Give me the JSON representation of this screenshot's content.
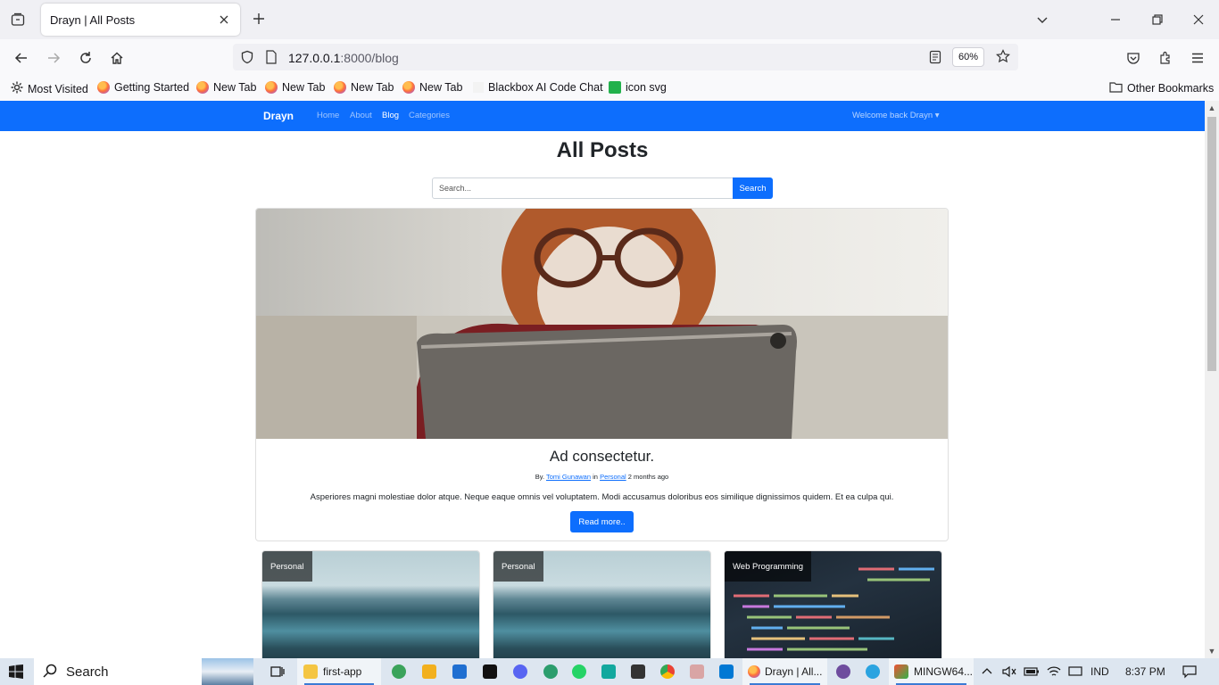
{
  "browser": {
    "tab_title": "Drayn | All Posts",
    "url_host": "127.0.0.1",
    "url_rest": ":8000/blog",
    "zoom": "60%"
  },
  "bookmarks": [
    "Most Visited",
    "Getting Started",
    "New Tab",
    "New Tab",
    "New Tab",
    "New Tab",
    "Blackbox AI Code Chat",
    "icon svg"
  ],
  "other_bookmarks": "Other Bookmarks",
  "site": {
    "brand": "Drayn",
    "nav": [
      "Home",
      "About",
      "Blog",
      "Categories"
    ],
    "welcome": "Welcome back Drayn ▾"
  },
  "page": {
    "title": "All Posts",
    "search_placeholder": "Search...",
    "search_button": "Search"
  },
  "hero": {
    "title": "Ad consectetur.",
    "by": "By.",
    "author": "Tomi Gunawan",
    "in": "in",
    "category": "Personal",
    "time": "2 months ago",
    "excerpt": "Asperiores magni molestiae dolor atque. Neque eaque omnis vel voluptatem. Modi accusamus doloribus eos similique dignissimos quidem. Et ea culpa qui.",
    "read_more": "Read more.."
  },
  "posts": [
    {
      "category": "Personal"
    },
    {
      "category": "Personal"
    },
    {
      "category": "Web Programming"
    }
  ],
  "taskbar": {
    "search": "Search",
    "first_app": "first-app",
    "drayn": "Drayn | All...",
    "mingw": "MINGW64...",
    "lang": "IND",
    "time": "8:37 PM"
  },
  "colors": {
    "primary": "#0d6efd",
    "chrome": "#f0f0f4"
  }
}
